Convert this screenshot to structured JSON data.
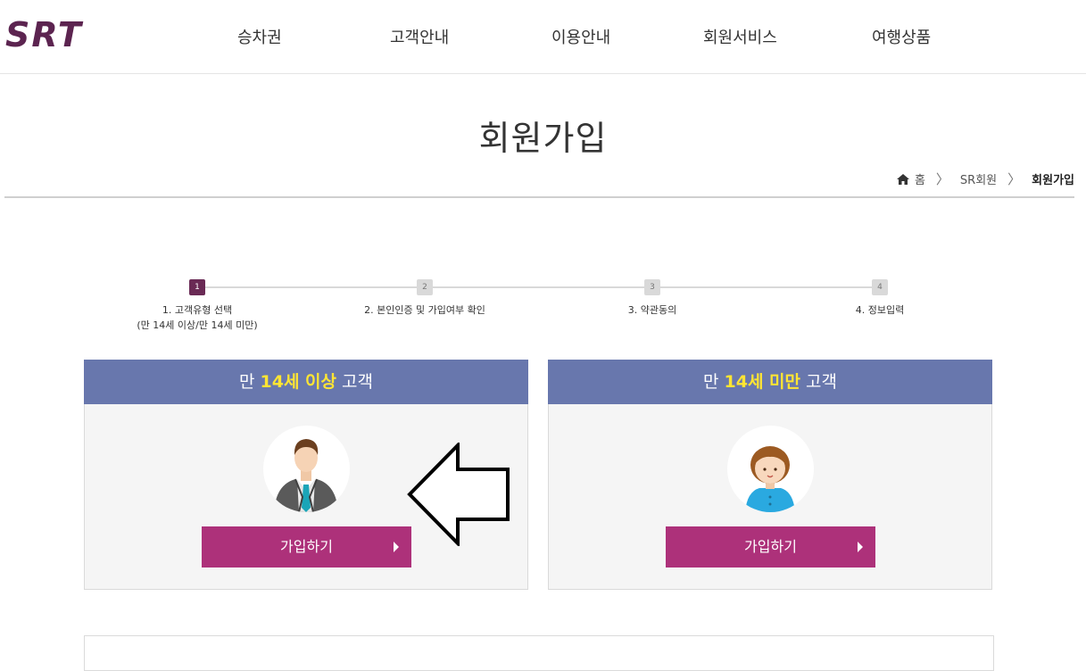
{
  "header": {
    "logo_text": "SRT",
    "nav": [
      "승차권",
      "고객안내",
      "이용안내",
      "회원서비스",
      "여행상품"
    ]
  },
  "page": {
    "title": "회원가입"
  },
  "breadcrumb": {
    "home": "홈",
    "level1": "SR회원",
    "current": "회원가입"
  },
  "steps": [
    {
      "num": "1",
      "label_line1": "1. 고객유형 선택",
      "label_line2": "(만 14세 이상/만 14세 미만)",
      "active": true
    },
    {
      "num": "2",
      "label_line1": "2. 본인인증 및 가입여부 확인",
      "label_line2": "",
      "active": false
    },
    {
      "num": "3",
      "label_line1": "3. 약관동의",
      "label_line2": "",
      "active": false
    },
    {
      "num": "4",
      "label_line1": "4. 정보입력",
      "label_line2": "",
      "active": false
    }
  ],
  "panels": {
    "adult": {
      "prefix": "만 ",
      "highlight": "14세 이상",
      "suffix": " 고객",
      "button_label": "가입하기",
      "icon": "adult-man-icon"
    },
    "child": {
      "prefix": "만 ",
      "highlight": "14세 미만",
      "suffix": " 고객",
      "button_label": "가입하기",
      "icon": "child-icon"
    }
  },
  "colors": {
    "brand_purple": "#6a2a55",
    "panel_header": "#6877ad",
    "highlight_yellow": "#ffe533",
    "button": "#ad317a"
  }
}
